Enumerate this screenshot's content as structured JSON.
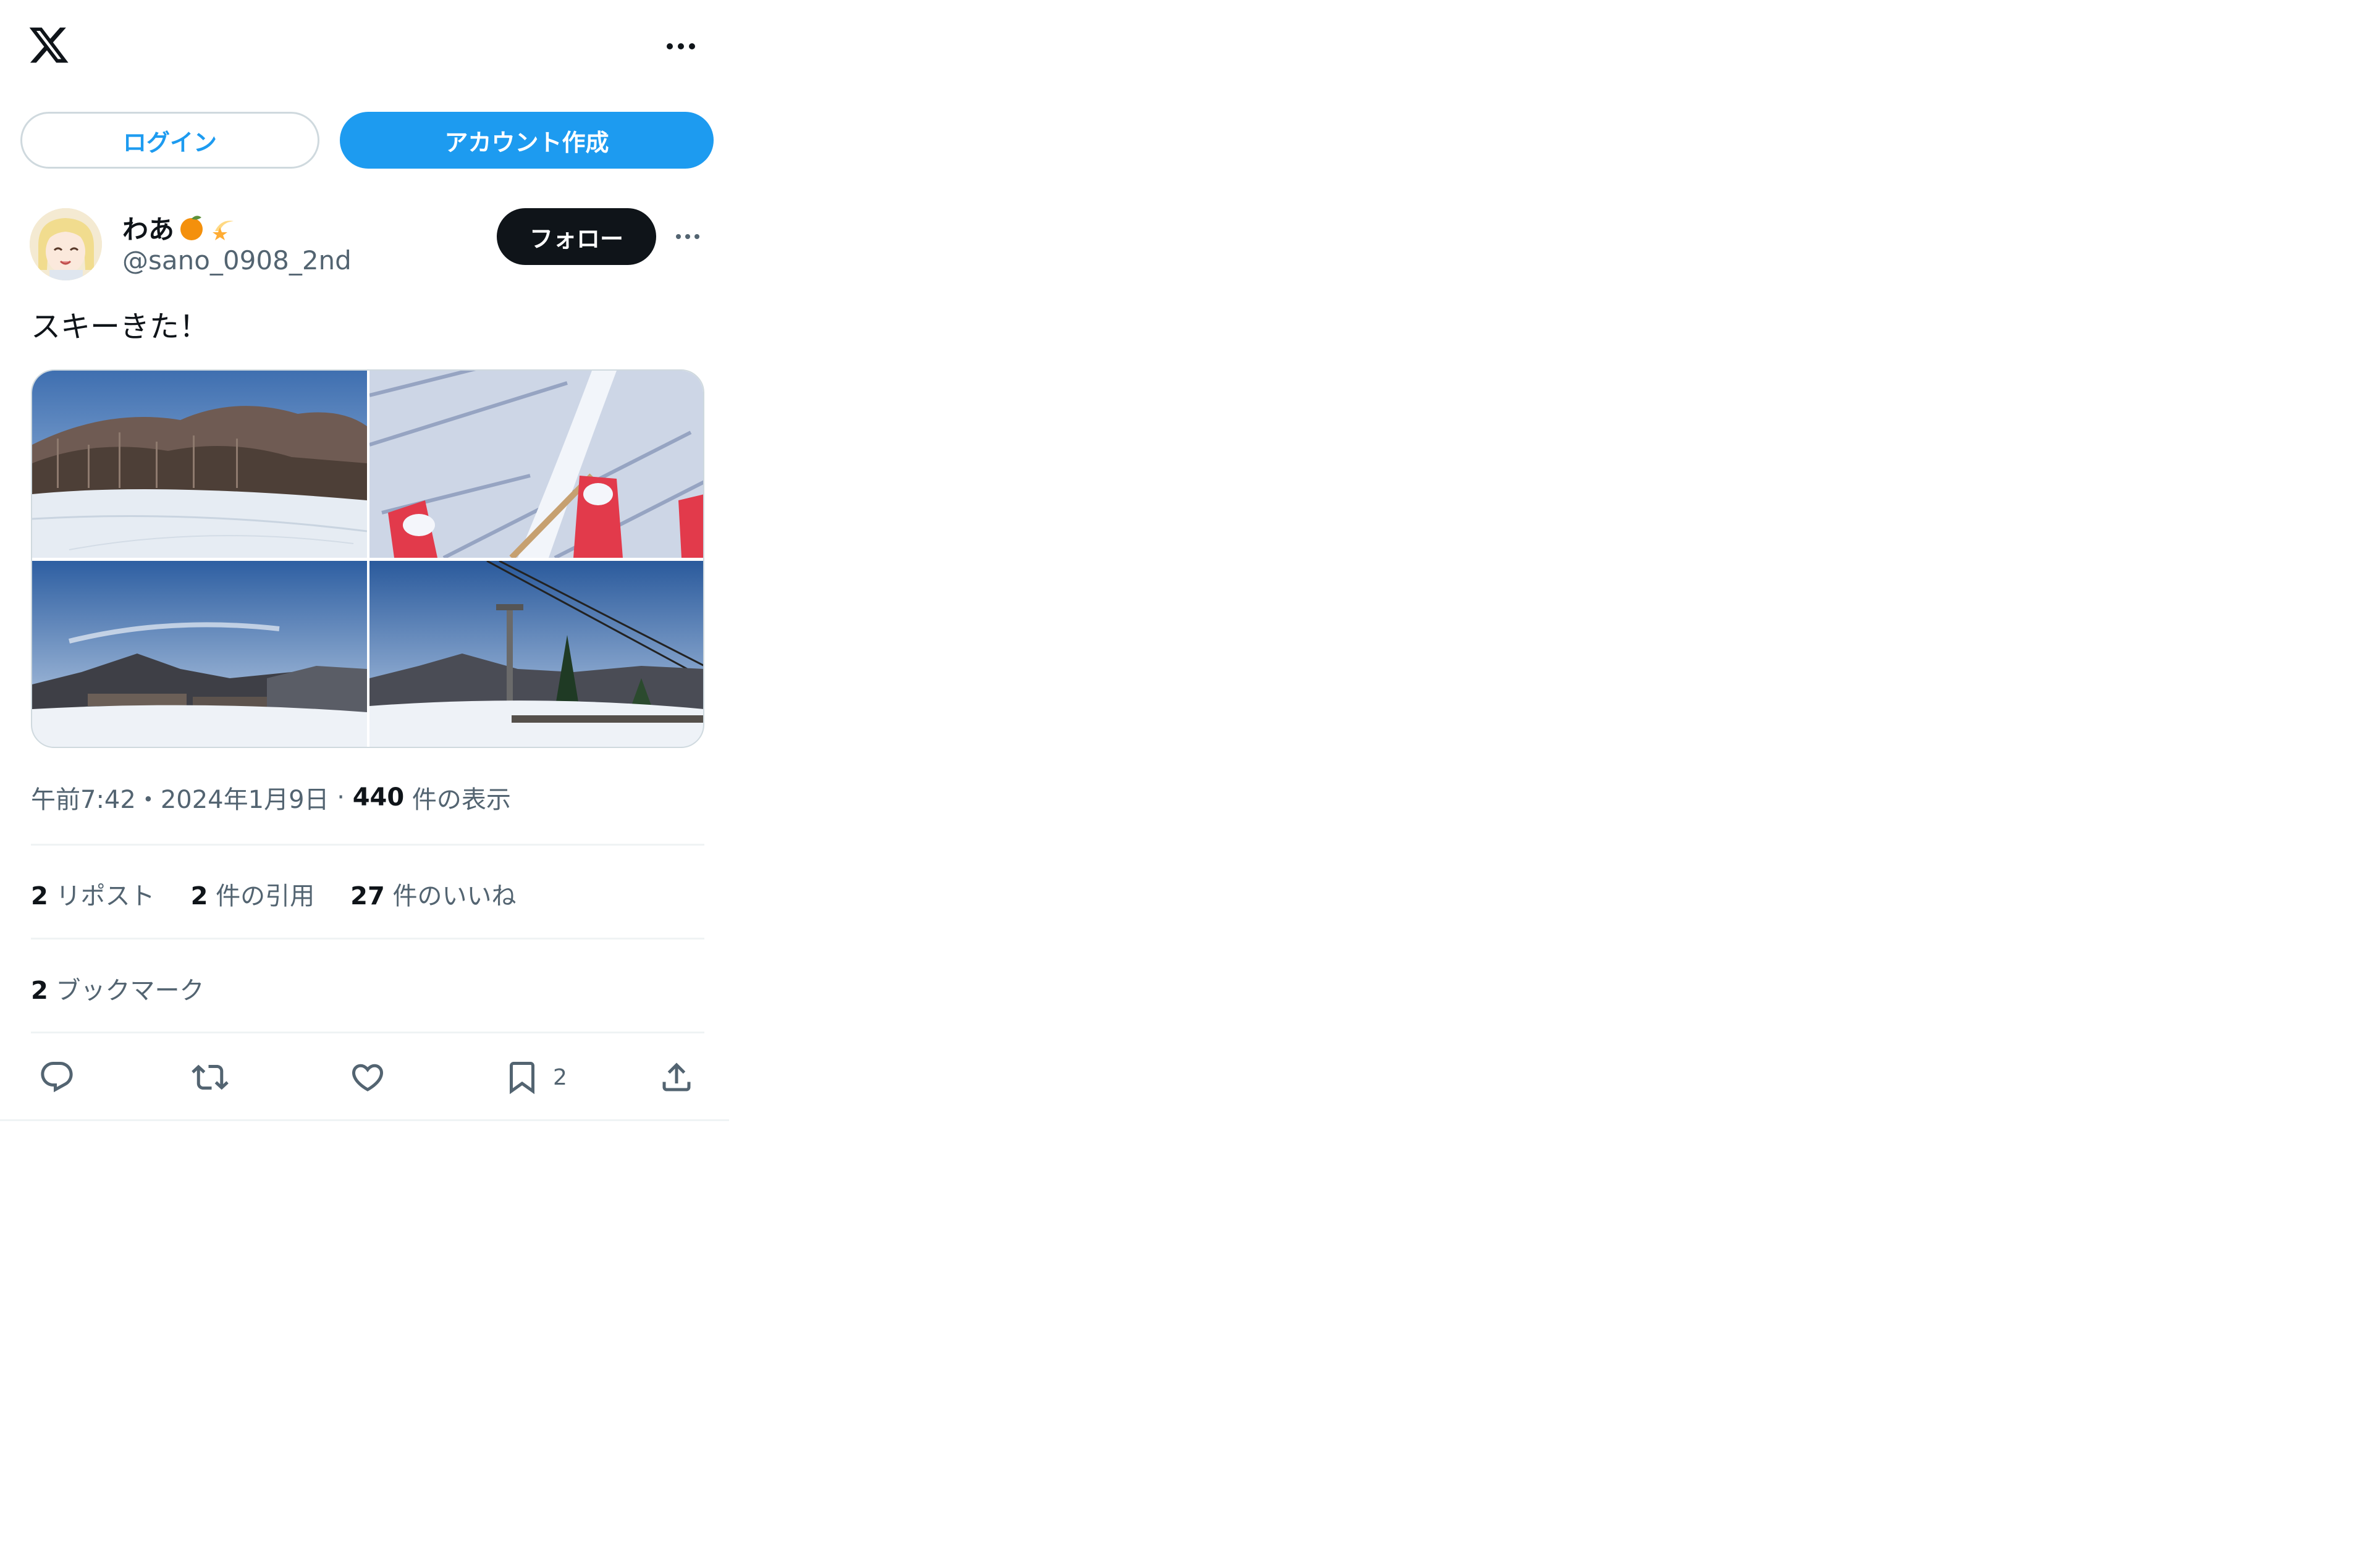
{
  "header": {
    "logo_icon": "x-logo-icon",
    "more_icon": "more-horizontal-icon"
  },
  "auth": {
    "login_label": "ログイン",
    "signup_label": "アカウント作成"
  },
  "tweet": {
    "author": {
      "display_name": "わあ",
      "emojis": [
        "orange-emoji",
        "dizzy-star-emoji"
      ],
      "handle": "@sano_0908_2nd",
      "avatar_icon": "anime-avatar"
    },
    "follow_label": "フォロー",
    "text": "スキーきた！",
    "media": [
      {
        "name": "ski-slope-birch-forest-photo"
      },
      {
        "name": "ski-boots-snow-photo"
      },
      {
        "name": "mountain-ski-resort-photo"
      },
      {
        "name": "ski-lift-cable-photo"
      }
    ],
    "meta": {
      "time": "午前7:42",
      "sep1": "・",
      "date": "2024年1月9日",
      "sep2": " · ",
      "views_count": "440",
      "views_label": " 件の表示"
    },
    "stats": {
      "reposts_count": "2",
      "reposts_label": " リポスト",
      "quotes_count": "2",
      "quotes_label": " 件の引用",
      "likes_count": "27",
      "likes_label": " 件のいいね"
    },
    "bookmarks": {
      "count": "2",
      "label": " ブックマーク"
    },
    "actions": {
      "reply_icon": "reply-icon",
      "retweet_icon": "retweet-icon",
      "like_icon": "heart-icon",
      "bookmark_icon": "bookmark-icon",
      "bookmark_count": "2",
      "share_icon": "share-icon"
    }
  },
  "colors": {
    "accent": "#1d9bf0",
    "text": "#0f1419",
    "muted": "#536471",
    "border": "#eff3f4"
  }
}
